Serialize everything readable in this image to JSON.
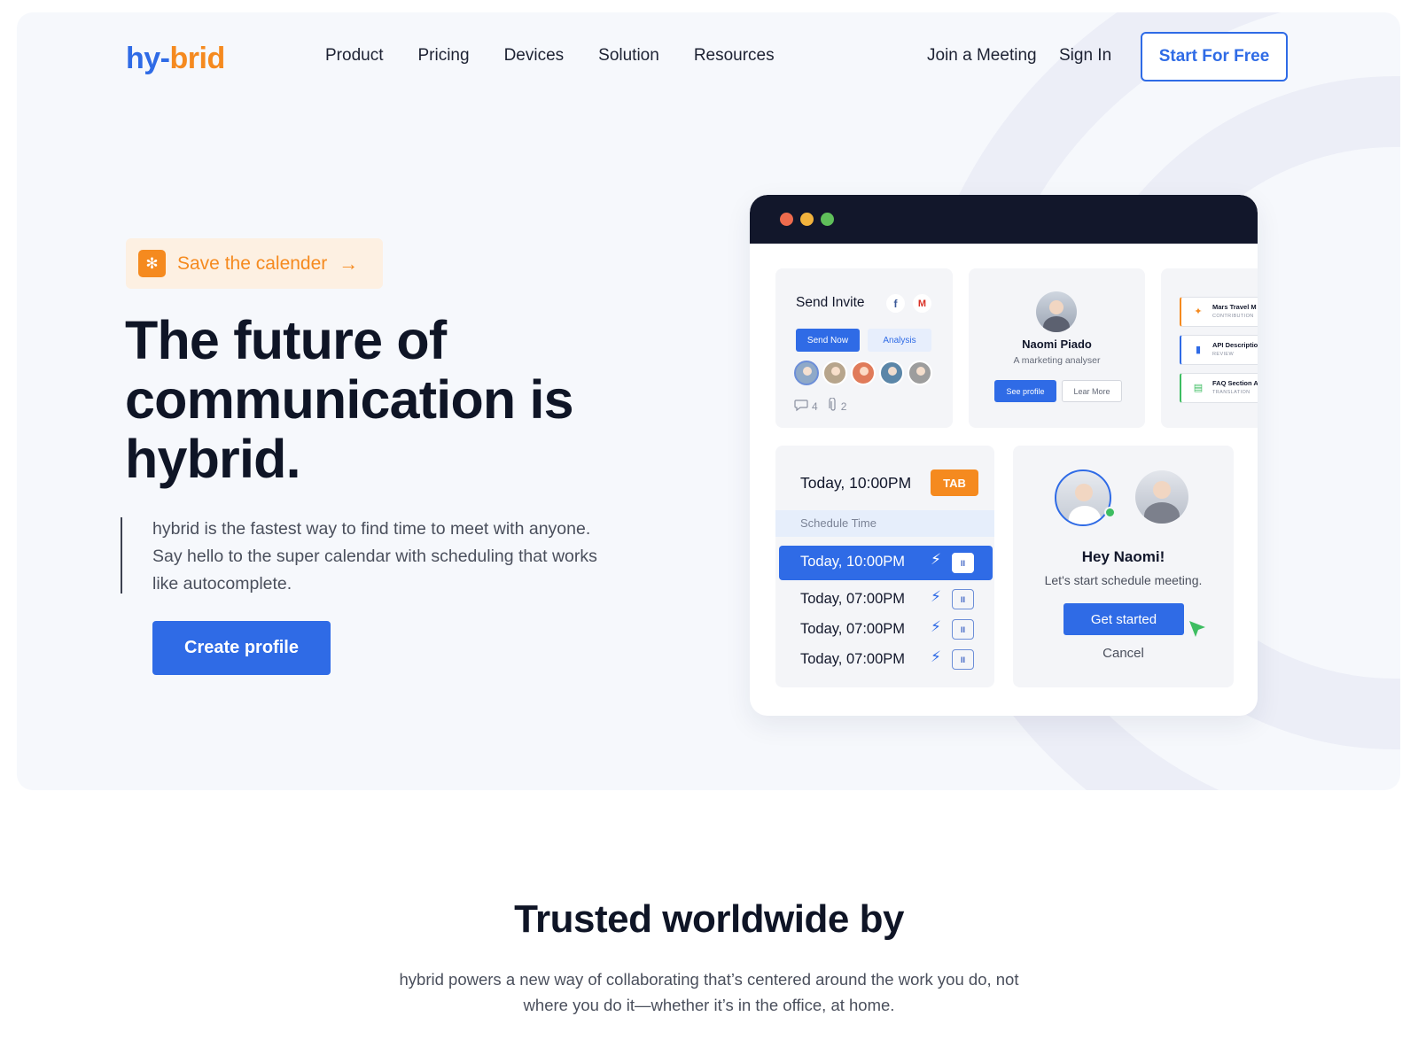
{
  "logo": {
    "part1": "hy-",
    "part2": "brid"
  },
  "nav": {
    "items": [
      {
        "label": "Product"
      },
      {
        "label": "Pricing"
      },
      {
        "label": "Devices"
      },
      {
        "label": "Solution"
      },
      {
        "label": "Resources"
      }
    ],
    "join_label": "Join a Meeting",
    "signin_label": "Sign In",
    "cta_label": "Start For Free"
  },
  "hero": {
    "badge_label": "Save the calender",
    "badge_icon": "gear-icon",
    "headline": "The future of communication is hybrid.",
    "description": "hybrid is the fastest way to find time to meet with anyone. Say hello to the super calendar with scheduling that works like autocomplete.",
    "cta_label": "Create profile"
  },
  "mock": {
    "send_invite": {
      "title": "Send Invite",
      "fb_icon": "f",
      "gmail_icon": "M",
      "send_now": "Send Now",
      "analysis": "Analysis",
      "avatars": [
        "#8fa9c8",
        "#b7a58c",
        "#e07b5a",
        "#5b86a8",
        "#9d9d9d"
      ],
      "comments": "4",
      "attachments": "2"
    },
    "profile": {
      "name": "Naomi Piado",
      "role": "A marketing analyser",
      "see_profile": "See profile",
      "learn_more": "Lear More"
    },
    "tasks": [
      {
        "title": "Mars Travel M",
        "sub": "CONTRIBUTION",
        "icon": "megaphone-icon",
        "color": "#f58a1f"
      },
      {
        "title": "API Descriptio",
        "sub": "REVIEW",
        "icon": "chart-icon",
        "color": "#2f6be6"
      },
      {
        "title": "FAQ Section A",
        "sub": "TRANSLATION",
        "icon": "document-icon",
        "color": "#3dbd61"
      }
    ],
    "schedule": {
      "header": "Today, 10:00PM",
      "tab_label": "TAB",
      "section_label": "Schedule Time",
      "rows": [
        {
          "time": "Today, 10:00PM"
        },
        {
          "time": "Today, 07:00PM"
        },
        {
          "time": "Today, 07:00PM"
        },
        {
          "time": "Today, 07:00PM"
        }
      ]
    },
    "greeting": {
      "title": "Hey Naomi!",
      "subtitle": "Let's start schedule meeting.",
      "cta": "Get started",
      "cancel": "Cancel"
    }
  },
  "trusted": {
    "title": "Trusted worldwide by",
    "description": "hybrid powers a new way of collaborating that’s centered around the work you do, not where you do it—whether it’s in the office, at home."
  }
}
